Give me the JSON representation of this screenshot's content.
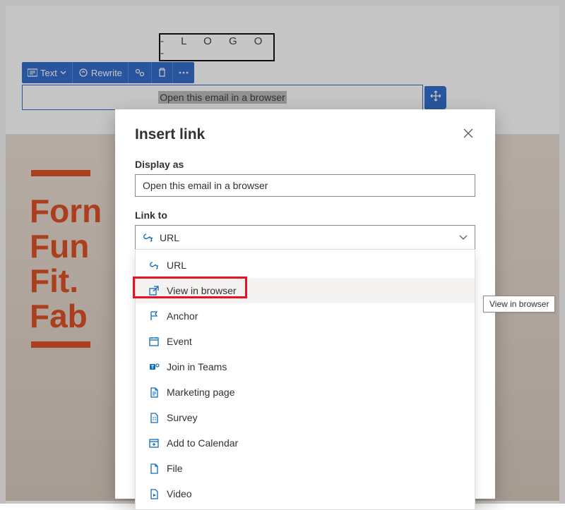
{
  "logo": "- L O G O -",
  "toolbar": {
    "text_label": "Text",
    "rewrite_label": "Rewrite"
  },
  "textblock": {
    "content": "Open this email in a browser"
  },
  "hero": {
    "line1": "Forn",
    "line2": "Fun",
    "line3": "Fit.",
    "line4": "Fab"
  },
  "modal": {
    "title": "Insert link",
    "display_as_label": "Display as",
    "display_as_value": "Open this email in a browser",
    "link_to_label": "Link to",
    "selected": "URL",
    "options": [
      {
        "label": "URL",
        "icon": "link-icon"
      },
      {
        "label": "View in browser",
        "icon": "external-icon"
      },
      {
        "label": "Anchor",
        "icon": "flag-icon"
      },
      {
        "label": "Event",
        "icon": "calendar-icon"
      },
      {
        "label": "Join in Teams",
        "icon": "teams-icon"
      },
      {
        "label": "Marketing page",
        "icon": "page-icon"
      },
      {
        "label": "Survey",
        "icon": "survey-icon"
      },
      {
        "label": "Add to Calendar",
        "icon": "cal-add-icon"
      },
      {
        "label": "File",
        "icon": "file-icon"
      },
      {
        "label": "Video",
        "icon": "video-icon"
      }
    ]
  },
  "tooltip": "View in browser"
}
